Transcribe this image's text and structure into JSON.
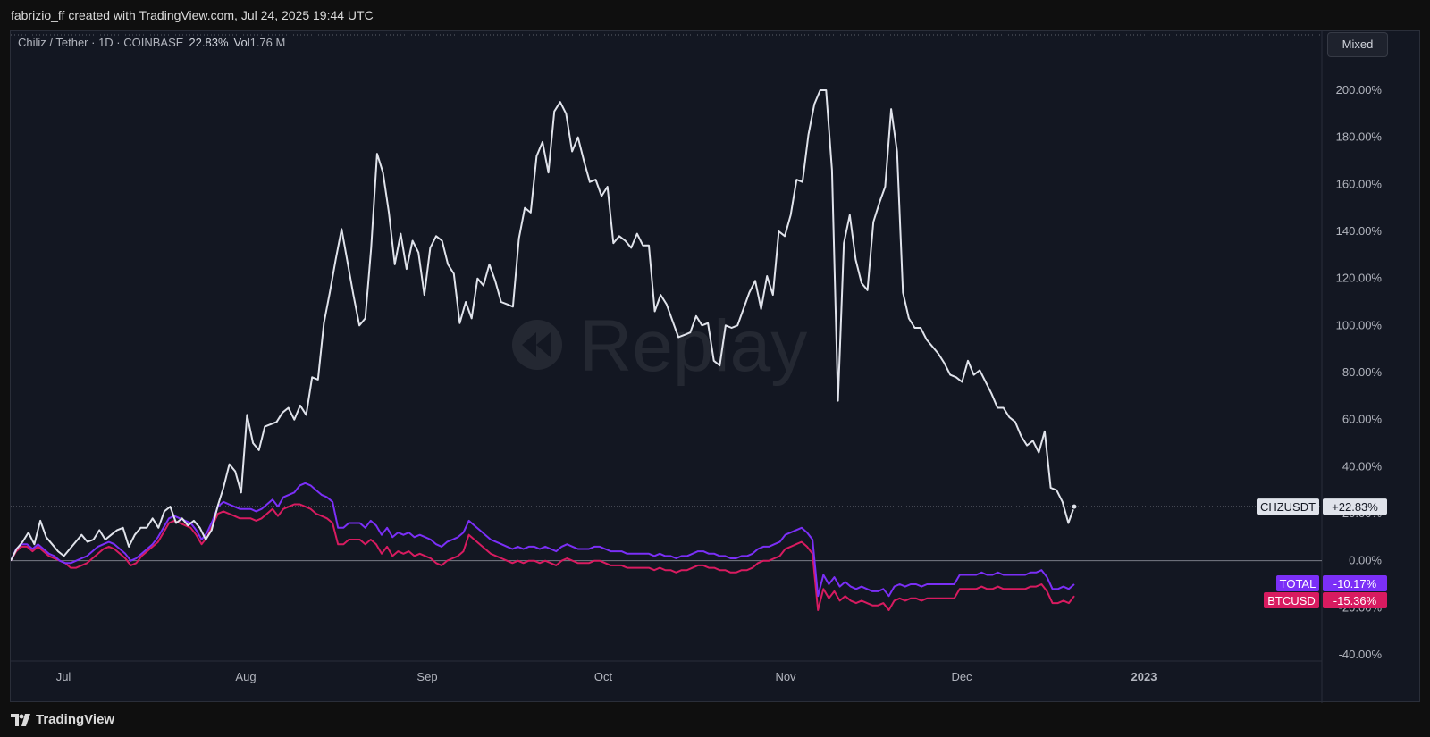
{
  "header": {
    "attribution": "fabrizio_ff created with TradingView.com, Jul 24, 2025 19:44 UTC"
  },
  "legend": {
    "symbol": "Chiliz / Tether · 1D · COINBASE",
    "change": "22.83%",
    "volume_label": "Vol",
    "volume": "1.76 M"
  },
  "toolbar": {
    "scale_mode": "Mixed"
  },
  "watermark": "Replay",
  "footer": {
    "brand": "TradingView"
  },
  "colors": {
    "chz": "#e0e3eb",
    "total": "#7b2ff7",
    "btc": "#d81b60",
    "background": "#131722"
  },
  "chart_data": {
    "type": "line",
    "x_axis_labels": [
      "Jul",
      "Aug",
      "Sep",
      "Oct",
      "Nov",
      "Dec",
      "2023"
    ],
    "y_axis_labels": [
      "200.00%",
      "180.00%",
      "160.00%",
      "140.00%",
      "120.00%",
      "100.00%",
      "80.00%",
      "60.00%",
      "40.00%",
      "20.00%",
      "0.00%",
      "-20.00%",
      "-40.00%"
    ],
    "ylim": [
      -40,
      200
    ],
    "y_unit": "%",
    "grid": false,
    "series": [
      {
        "name": "CHZUSDT",
        "last_label": "+22.83%",
        "values": [
          0,
          5,
          8,
          12,
          7,
          17,
          10,
          7,
          4,
          2,
          5,
          8,
          11,
          8,
          9,
          13,
          9,
          11,
          13,
          14,
          6,
          11,
          14,
          14,
          18,
          14,
          21,
          23,
          16,
          18,
          15,
          17,
          14,
          9,
          13,
          23,
          31,
          41,
          38,
          29,
          62,
          50,
          47,
          57,
          58,
          59,
          63,
          65,
          60,
          66,
          62,
          78,
          77,
          101,
          114,
          128,
          141,
          127,
          113,
          100,
          103,
          133,
          173,
          165,
          148,
          126,
          139,
          124,
          136,
          131,
          113,
          133,
          138,
          136,
          126,
          122,
          101,
          110,
          103,
          120,
          117,
          126,
          119,
          110,
          109,
          108,
          137,
          150,
          148,
          172,
          178,
          165,
          191,
          195,
          190,
          174,
          180,
          170,
          161,
          162,
          155,
          159,
          135,
          138,
          136,
          133,
          139,
          134,
          134,
          106,
          113,
          109,
          102,
          95,
          96,
          97,
          104,
          100,
          101,
          85,
          83,
          100,
          99,
          100,
          107,
          114,
          119,
          107,
          121,
          113,
          140,
          138,
          147,
          162,
          161,
          181,
          194,
          200,
          200,
          166,
          68,
          135,
          147,
          128,
          118,
          115,
          144,
          152,
          159,
          192,
          174,
          114,
          103,
          99,
          99,
          94,
          91,
          88,
          84,
          79,
          78,
          76,
          85,
          79,
          81,
          76,
          71,
          65,
          65,
          61,
          59,
          53,
          49,
          51,
          46,
          55,
          31,
          30,
          25,
          16,
          23
        ]
      },
      {
        "name": "TOTAL",
        "last_label": "-10.17%",
        "values": [
          0,
          5,
          7,
          7,
          5,
          7,
          5,
          3,
          2,
          0,
          -1,
          -1,
          0,
          1,
          2,
          4,
          6,
          7,
          8,
          7,
          5,
          3,
          0,
          1,
          3,
          5,
          7,
          10,
          14,
          18,
          19,
          18,
          17,
          16,
          13,
          9,
          12,
          17,
          23,
          25,
          24,
          23,
          22,
          22,
          22,
          21,
          22,
          24,
          26,
          23,
          27,
          28,
          29,
          32,
          33,
          32,
          30,
          28,
          27,
          25,
          14,
          14,
          16,
          16,
          16,
          14,
          17,
          15,
          11,
          14,
          10,
          12,
          11,
          12,
          10,
          11,
          10,
          9,
          7,
          6,
          8,
          9,
          10,
          12,
          17,
          15,
          13,
          11,
          9,
          8,
          7,
          6,
          5,
          6,
          5,
          6,
          6,
          5,
          6,
          5,
          4,
          6,
          7,
          6,
          5,
          5,
          5,
          6,
          6,
          5,
          4,
          4,
          4,
          3,
          3,
          3,
          3,
          3,
          2,
          3,
          2,
          2,
          1,
          2,
          2,
          3,
          4,
          4,
          3,
          3,
          2,
          2,
          1,
          1,
          2,
          2,
          3,
          5,
          6,
          6,
          7,
          8,
          11,
          12,
          13,
          14,
          12,
          9,
          -15,
          -6,
          -10,
          -7,
          -11,
          -9,
          -11,
          -12,
          -11,
          -12,
          -13,
          -13,
          -12,
          -15,
          -11,
          -10,
          -11,
          -10,
          -10,
          -11,
          -10,
          -10,
          -10,
          -10,
          -10,
          -10,
          -6,
          -6,
          -6,
          -6,
          -5,
          -6,
          -6,
          -5,
          -6,
          -6,
          -6,
          -6,
          -6,
          -5,
          -5,
          -4,
          -7,
          -12,
          -12,
          -11,
          -12,
          -10
        ]
      },
      {
        "name": "BTCUSD",
        "last_label": "-15.36%",
        "values": [
          0,
          4,
          6,
          6,
          4,
          6,
          4,
          2,
          1,
          0,
          -1,
          -3,
          -3,
          -2,
          -1,
          1,
          3,
          5,
          6,
          5,
          3,
          1,
          -2,
          -1,
          2,
          4,
          6,
          8,
          12,
          16,
          17,
          16,
          15,
          14,
          11,
          7,
          10,
          15,
          20,
          21,
          20,
          19,
          18,
          18,
          18,
          17,
          18,
          20,
          22,
          19,
          22,
          23,
          24,
          24,
          23,
          22,
          20,
          19,
          18,
          16,
          7,
          7,
          9,
          9,
          9,
          7,
          9,
          7,
          3,
          6,
          2,
          4,
          3,
          4,
          2,
          3,
          2,
          1,
          -1,
          -2,
          0,
          1,
          2,
          4,
          11,
          9,
          7,
          5,
          3,
          2,
          1,
          0,
          -1,
          0,
          -1,
          0,
          0,
          -1,
          0,
          -1,
          -2,
          0,
          1,
          0,
          -1,
          -1,
          -1,
          0,
          0,
          -1,
          -2,
          -2,
          -2,
          -3,
          -3,
          -3,
          -3,
          -3,
          -4,
          -3,
          -4,
          -4,
          -5,
          -4,
          -4,
          -3,
          -2,
          -2,
          -3,
          -3,
          -4,
          -4,
          -5,
          -5,
          -4,
          -4,
          -3,
          -1,
          0,
          0,
          1,
          2,
          5,
          6,
          7,
          8,
          6,
          3,
          -21,
          -12,
          -16,
          -13,
          -17,
          -15,
          -17,
          -18,
          -17,
          -18,
          -19,
          -19,
          -18,
          -21,
          -17,
          -16,
          -17,
          -16,
          -16,
          -17,
          -16,
          -16,
          -16,
          -16,
          -16,
          -16,
          -12,
          -12,
          -12,
          -12,
          -11,
          -12,
          -12,
          -11,
          -12,
          -12,
          -12,
          -12,
          -12,
          -11,
          -11,
          -10,
          -13,
          -18,
          -18,
          -17,
          -18,
          -15
        ]
      }
    ]
  }
}
